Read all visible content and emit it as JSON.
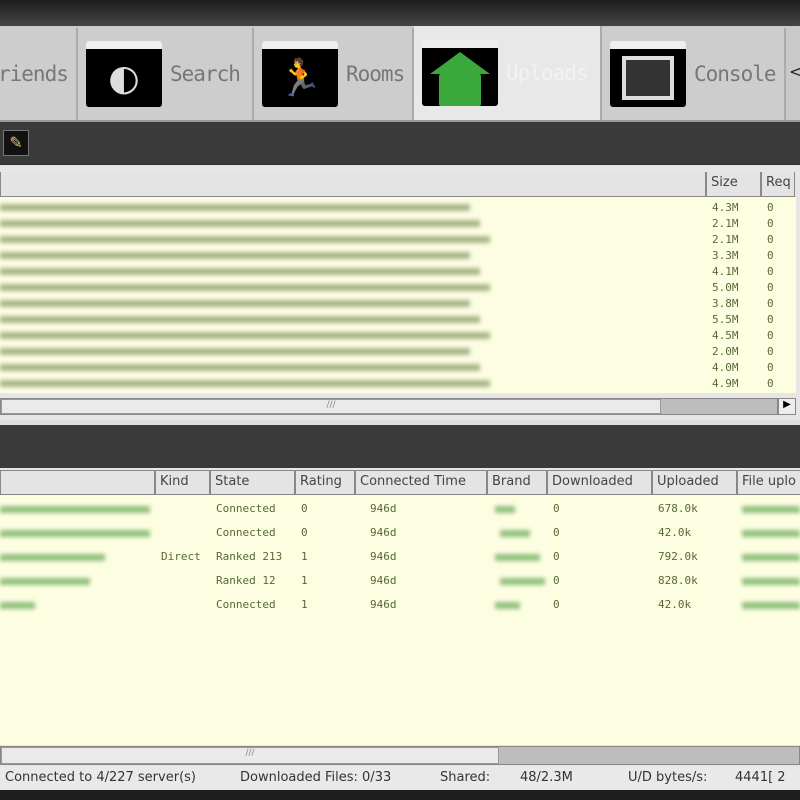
{
  "tabs": [
    {
      "label": "riends",
      "icon": "friends-icon"
    },
    {
      "label": "Search",
      "icon": "search-icon"
    },
    {
      "label": "Rooms",
      "icon": "rooms-icon"
    },
    {
      "label": "Uploads",
      "icon": "uploads-penguin-icon",
      "active": true
    },
    {
      "label": "Console",
      "icon": "console-icon"
    }
  ],
  "tab_scroll": "<",
  "upper_table": {
    "columns": [
      "",
      "Size",
      "Req"
    ],
    "rows": [
      {
        "size": "4.3M",
        "req": "0"
      },
      {
        "size": "2.1M",
        "req": "0"
      },
      {
        "size": "2.1M",
        "req": "0"
      },
      {
        "size": "3.3M",
        "req": "0"
      },
      {
        "size": "4.1M",
        "req": "0"
      },
      {
        "size": "5.0M",
        "req": "0"
      },
      {
        "size": "3.8M",
        "req": "0"
      },
      {
        "size": "5.5M",
        "req": "0"
      },
      {
        "size": "4.5M",
        "req": "0"
      },
      {
        "size": "2.0M",
        "req": "0"
      },
      {
        "size": "4.0M",
        "req": "0"
      },
      {
        "size": "4.9M",
        "req": "0"
      }
    ]
  },
  "lower_table": {
    "columns": [
      "",
      "Kind",
      "State",
      "Rating",
      "Connected Time",
      "Brand",
      "Downloaded",
      "Uploaded",
      "File uplo"
    ],
    "rows": [
      {
        "kind": "",
        "state": "Connected",
        "rating": "0",
        "time": "946d",
        "downloaded": "0",
        "uploaded": "678.0k"
      },
      {
        "kind": "",
        "state": "Connected",
        "rating": "0",
        "time": "946d",
        "downloaded": "0",
        "uploaded": "42.0k"
      },
      {
        "kind": "Direct",
        "state": "Ranked 213",
        "rating": "1",
        "time": "946d",
        "downloaded": "0",
        "uploaded": "792.0k"
      },
      {
        "kind": "",
        "state": "Ranked 12",
        "rating": "1",
        "time": "946d",
        "downloaded": "0",
        "uploaded": "828.0k"
      },
      {
        "kind": "",
        "state": "Connected",
        "rating": "1",
        "time": "946d",
        "downloaded": "0",
        "uploaded": "42.0k"
      }
    ]
  },
  "status": {
    "servers": "Connected to 4/227 server(s)",
    "downloaded": "Downloaded Files: 0/33",
    "shared_label": "Shared:",
    "shared": "48/2.3M",
    "ud_label": "U/D bytes/s:",
    "ud": "4441[  2"
  }
}
